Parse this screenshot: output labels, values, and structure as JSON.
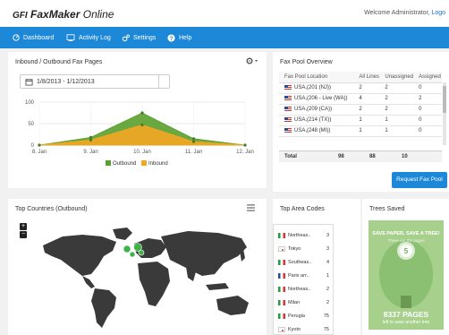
{
  "header": {
    "logo_gfi": "GFI",
    "logo_product": "FaxMaker",
    "logo_suffix": "Online",
    "welcome_text": "Welcome Administrator,",
    "logout_label": "Logo"
  },
  "nav": [
    {
      "label": "Dashboard",
      "icon": "dashboard-icon"
    },
    {
      "label": "Activity Log",
      "icon": "log-icon"
    },
    {
      "label": "Settings",
      "icon": "settings-icon"
    },
    {
      "label": "Help",
      "icon": "help-icon"
    }
  ],
  "inbound_panel": {
    "title": "Inbound / Outbound Fax Pages",
    "date_range": "1/8/2013 - 1/12/2013"
  },
  "chart_data": {
    "type": "area",
    "categories": [
      "8. Jan",
      "9. Jan",
      "10. Jan",
      "11. Jan",
      "12. Jan"
    ],
    "series": [
      {
        "name": "Outbound",
        "values": [
          0,
          18,
          75,
          15,
          0
        ],
        "color": "#5aa02c"
      },
      {
        "name": "Inbound",
        "values": [
          0,
          12,
          47,
          8,
          0
        ],
        "color": "#f5a623"
      }
    ],
    "yticks": [
      0,
      50,
      100
    ],
    "ylim": [
      0,
      100
    ],
    "grid": true,
    "legend_position": "bottom"
  },
  "fax_pool": {
    "title": "Fax Pool Overview",
    "columns": [
      "Fax Pool Location",
      "All Lines",
      "Unassigned",
      "Assigned"
    ],
    "rows": [
      {
        "location": "USA,(201 (NJ))",
        "all": "2",
        "unassigned": "2",
        "assigned": "0"
      },
      {
        "location": "USA,(206 - Live (WA))",
        "all": "4",
        "unassigned": "2",
        "assigned": "2"
      },
      {
        "location": "USA,(209 (CA))",
        "all": "2",
        "unassigned": "2",
        "assigned": "0"
      },
      {
        "location": "USA,(214 (TX))",
        "all": "1",
        "unassigned": "1",
        "assigned": "0"
      },
      {
        "location": "USA,(248 (MI))",
        "all": "1",
        "unassigned": "1",
        "assigned": "0"
      }
    ],
    "total_label": "Total",
    "total_all": "98",
    "total_unassigned": "88",
    "total_assigned": "10",
    "request_button": "Request Fax Pool"
  },
  "top_countries": {
    "title": "Top Countries (Outbound)",
    "zoom_in": "+",
    "zoom_out": "−"
  },
  "top_area_codes": {
    "title": "Top Area Codes",
    "rows": [
      {
        "name": "Northeas..",
        "count": "3",
        "flag": "it"
      },
      {
        "name": "Tokyo",
        "count": "3",
        "flag": "jp"
      },
      {
        "name": "Southeas..",
        "count": "4",
        "flag": "it"
      },
      {
        "name": "Paris arr..",
        "count": "1",
        "flag": "fr"
      },
      {
        "name": "Northeas..",
        "count": "2",
        "flag": "it"
      },
      {
        "name": "Milan",
        "count": "2",
        "flag": "it"
      },
      {
        "name": "Perugia",
        "count": "75",
        "flag": "it"
      },
      {
        "name": "Kyoto",
        "count": "75",
        "flag": "jp"
      }
    ]
  },
  "trees": {
    "title": "Trees Saved",
    "slogan": "SAVE PAPER, SAVE A TREE!",
    "subslogan": "These are the pages",
    "count_badge": "5",
    "pages": "8337 PAGES",
    "caption": "left to save another tree"
  },
  "colors": {
    "nav_blue": "#1d88d8",
    "outbound_green": "#5aa02c",
    "inbound_orange": "#f5a623",
    "tree_green": "#a8d08d"
  }
}
